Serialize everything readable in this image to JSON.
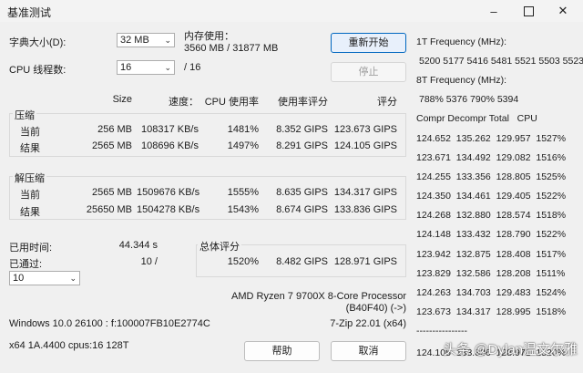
{
  "window": {
    "title": "基准测试"
  },
  "dict_size": {
    "label": "字典大小(D):",
    "value": "32 MB"
  },
  "threads": {
    "label": "CPU 线程数:",
    "value": "16",
    "total": "/ 16"
  },
  "memory": {
    "label": "内存使用：",
    "value": "3560 MB / 31877 MB"
  },
  "buttons": {
    "restart": "重新开始",
    "stop": "停止",
    "help": "帮助",
    "cancel": "取消"
  },
  "headers": {
    "size": "Size",
    "speed": "速度：",
    "cpu_usage": "CPU 使用率",
    "usage_rating": "使用率评分",
    "rating": "评分"
  },
  "compress": {
    "title": "压缩",
    "rows": [
      {
        "label": "当前",
        "size": "256 MB",
        "speed": "108317 KB/s",
        "cpu": "1481%",
        "urating": "8.352 GIPS",
        "rating": "123.673 GIPS"
      },
      {
        "label": "结果",
        "size": "2565 MB",
        "speed": "108696 KB/s",
        "cpu": "1497%",
        "urating": "8.291 GIPS",
        "rating": "124.105 GIPS"
      }
    ]
  },
  "decompress": {
    "title": "解压缩",
    "rows": [
      {
        "label": "当前",
        "size": "2565 MB",
        "speed": "1509676 KB/s",
        "cpu": "1555%",
        "urating": "8.635 GIPS",
        "rating": "134.317 GIPS"
      },
      {
        "label": "结果",
        "size": "25650 MB",
        "speed": "1504278 KB/s",
        "cpu": "1543%",
        "urating": "8.674 GIPS",
        "rating": "133.836 GIPS"
      }
    ]
  },
  "elapsed": {
    "label": "已用时间:",
    "value": "44.344 s"
  },
  "passed": {
    "label": "已通过:",
    "value": "10 /",
    "select_value": "10"
  },
  "total_rating": {
    "title": "总体评分",
    "cpu": "1520%",
    "urating": "8.482 GIPS",
    "rating": "128.971 GIPS"
  },
  "cpu_info": {
    "line1": "AMD Ryzen 7 9700X 8-Core Processor",
    "line2": "(B40F40) (->)"
  },
  "os_info": "Windows 10.0 26100 :  f:100007FB10E2774C",
  "version": "7-Zip 22.01 (x64)",
  "arch_info": "x64 1A.4400 cpus:16 128T",
  "log": {
    "freq1_label": "1T Frequency (MHz):",
    "freq1_values": "5200 5177 5416 5481 5521 5503 5523",
    "freq8_label": "8T Frequency (MHz):",
    "freq8_values": "788% 5376 790% 5394",
    "table_header": "Compr Decompr Total   CPU",
    "rows": [
      "124.652  135.262  129.957  1527%",
      "123.671  134.492  129.082  1516%",
      "124.255  133.356  128.805  1525%",
      "124.350  134.461  129.405  1522%",
      "124.268  132.880  128.574  1518%",
      "124.148  133.432  128.790  1522%",
      "123.942  132.875  128.408  1517%",
      "123.829  132.586  128.208  1511%",
      "124.263  134.703  129.483  1524%",
      "123.673  134.317  128.995  1518%"
    ],
    "separator": "----------------",
    "summary": "124.105  133.836  128.971  1520%"
  },
  "watermark": "头条 @Dylan温文尔雅"
}
